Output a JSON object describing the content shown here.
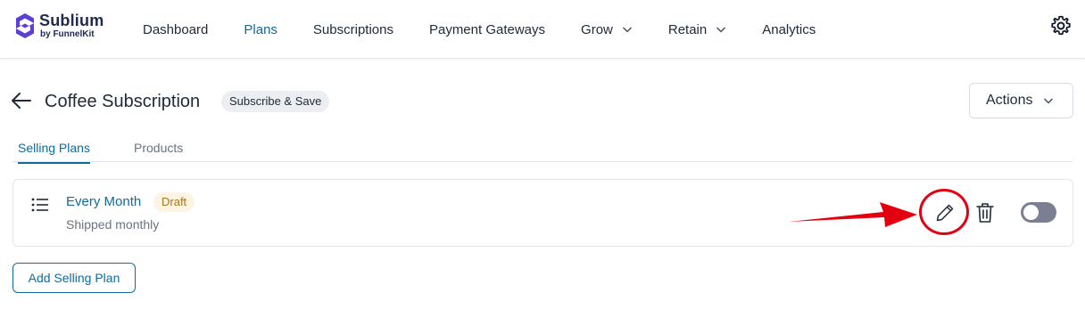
{
  "brand": {
    "name": "Sublium",
    "tagline_prefix": "by ",
    "tagline_brand": "FunnelKit",
    "color": "#5b3fd6"
  },
  "nav": {
    "items": [
      {
        "label": "Dashboard",
        "active": false
      },
      {
        "label": "Plans",
        "active": true
      },
      {
        "label": "Subscriptions",
        "active": false
      },
      {
        "label": "Payment Gateways",
        "active": false
      },
      {
        "label": "Grow",
        "active": false,
        "dropdown": true
      },
      {
        "label": "Retain",
        "active": false,
        "dropdown": true
      },
      {
        "label": "Analytics",
        "active": false
      }
    ],
    "settings_icon": "gear-icon"
  },
  "header": {
    "back_icon": "arrow-left-icon",
    "title": "Coffee Subscription",
    "type_badge": "Subscribe & Save",
    "actions_label": "Actions"
  },
  "tabs": [
    {
      "label": "Selling Plans",
      "active": true
    },
    {
      "label": "Products",
      "active": false
    }
  ],
  "plans": [
    {
      "name": "Every Month",
      "status": "Draft",
      "description": "Shipped monthly",
      "enabled": false
    }
  ],
  "add_plan_label": "Add Selling Plan",
  "colors": {
    "accent": "#0f6b9e",
    "draft_bg": "#fdf4e3",
    "draft_text": "#a8741a",
    "annotation": "#e3000f",
    "toggle_off": "#7b7f92"
  }
}
